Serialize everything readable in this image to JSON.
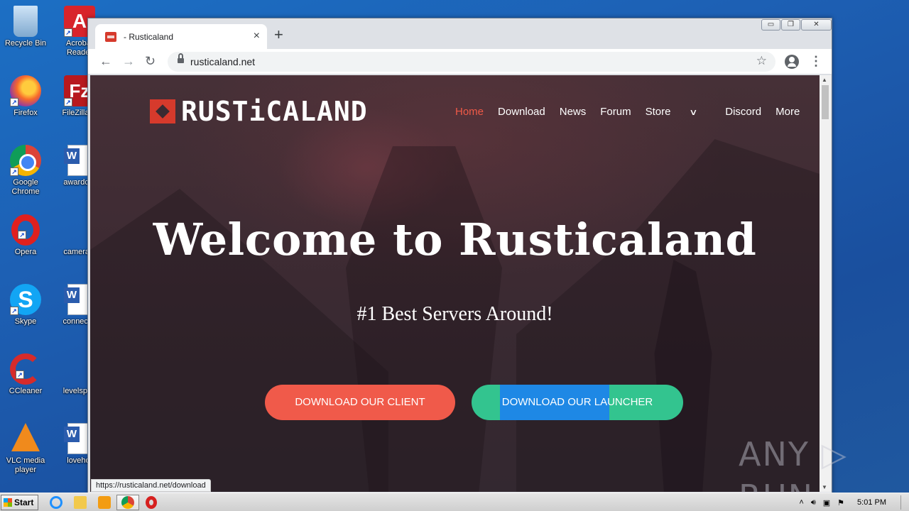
{
  "desktop": {
    "icons": [
      {
        "label": "Recycle Bin",
        "icon": "recycle-bin-icon"
      },
      {
        "label": "Acrobat Reader",
        "icon": "acrobat-reader-icon"
      },
      {
        "label": "Firefox",
        "icon": "firefox-icon"
      },
      {
        "label": "FileZilla C",
        "icon": "filezilla-icon"
      },
      {
        "label": "Google Chrome",
        "icon": "chrome-icon"
      },
      {
        "label": "awardcer",
        "icon": "word-document-icon"
      },
      {
        "label": "Opera",
        "icon": "opera-icon"
      },
      {
        "label": "camerast",
        "icon": "document-icon"
      },
      {
        "label": "Skype",
        "icon": "skype-icon"
      },
      {
        "label": "connectio",
        "icon": "word-document-icon"
      },
      {
        "label": "CCleaner",
        "icon": "ccleaner-icon"
      },
      {
        "label": "levelspop",
        "icon": "document-icon"
      },
      {
        "label": "VLC media player",
        "icon": "vlc-icon"
      },
      {
        "label": "lovehot",
        "icon": "word-document-icon"
      }
    ]
  },
  "browser": {
    "tab_title": "- Rusticaland",
    "tab_close": "×",
    "new_tab": "+",
    "url": "rusticaland.net",
    "back": "←",
    "forward": "→",
    "reload": "↻",
    "bookmark_star": "☆",
    "menu": "⋮",
    "status_url": "https://rusticaland.net/download",
    "window_controls": {
      "minimize": "▭",
      "restore": "❐",
      "close": "✕"
    }
  },
  "site": {
    "logo_text": "RUSTiCALAND",
    "nav": {
      "home": "Home",
      "download": "Download",
      "news": "News",
      "forum": "Forum",
      "store": "Store",
      "discord": "Discord",
      "more": "More",
      "caret": "∨"
    },
    "hero_title": "Welcome to Rusticaland",
    "hero_subtitle": "#1 Best Servers Around!",
    "btn_client": "DOWNLOAD OUR CLIENT",
    "btn_launcher": "DOWNLOAD OUR LAUNCHER"
  },
  "watermark": "ANY ▷ RUN",
  "taskbar": {
    "start_label": "Start",
    "clock": "5:01 PM",
    "tray_expand": "˄"
  },
  "colors": {
    "accent_red": "#f05a4a",
    "accent_green": "#33c48f",
    "highlight_blue": "#1e88e5",
    "nav_active": "#f05a47"
  }
}
